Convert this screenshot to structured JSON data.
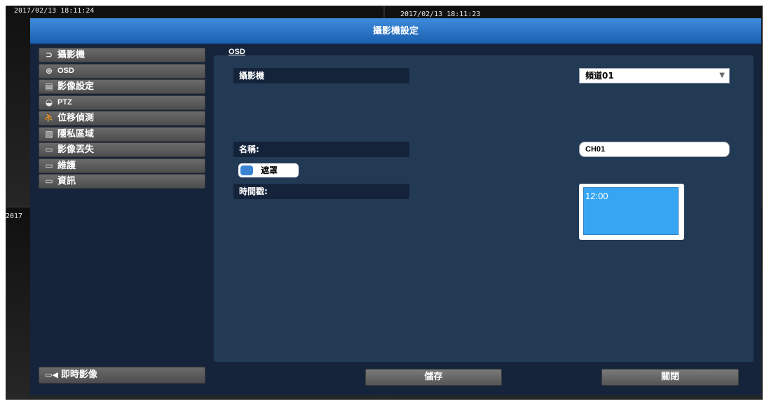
{
  "background": {
    "timestamp_left": "2017/02/13 18:11:24",
    "timestamp_center": "2017/02/13 18:11:23",
    "timestamp_mid_left": "2017"
  },
  "dialog": {
    "title": "攝影機設定",
    "section_title": "OSD"
  },
  "sidebar": {
    "items": [
      {
        "label": "攝影機",
        "icon": "camera-icon",
        "glyph": "⊃"
      },
      {
        "label": "OSD",
        "icon": "film-reel-icon",
        "glyph": "⊛"
      },
      {
        "label": "影像設定",
        "icon": "image-icon",
        "glyph": "▤"
      },
      {
        "label": "PTZ",
        "icon": "ptz-camera-icon",
        "glyph": "◒"
      },
      {
        "label": "位移偵測",
        "icon": "running-man-icon",
        "glyph": "⛹"
      },
      {
        "label": "隱私區域",
        "icon": "privacy-mask-icon",
        "glyph": "▨"
      },
      {
        "label": "影像丟失",
        "icon": "monitor-icon",
        "glyph": "▭"
      },
      {
        "label": "維護",
        "icon": "monitor-icon",
        "glyph": "▭"
      },
      {
        "label": "資訊",
        "icon": "monitor-icon",
        "glyph": "▭"
      }
    ],
    "live_button": {
      "label": "即時影像",
      "icon": "live-view-icon",
      "glyph": "▭◀"
    }
  },
  "form": {
    "camera_label": "攝影機",
    "camera_value": "頻道01",
    "name_label": "名稱:",
    "name_value": "CH01",
    "mask_label": "遮罩",
    "timestamp_label": "時間戳:",
    "timestamp_preview": "12:00"
  },
  "buttons": {
    "save": "儲存",
    "close": "關閉"
  },
  "colors": {
    "title_bar": "#2a73c5",
    "panel": "#233a55",
    "dialog_bg": "#15243b",
    "preview_fill": "#36a6f2"
  }
}
